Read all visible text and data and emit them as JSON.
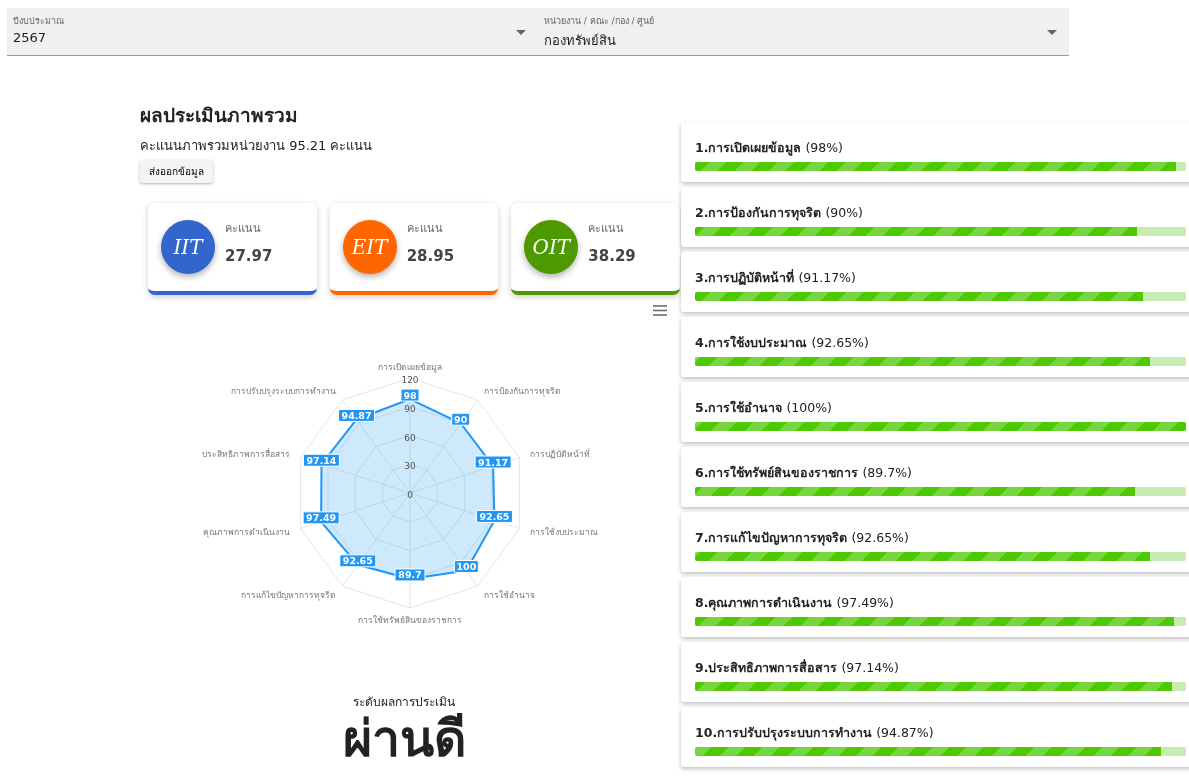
{
  "filters": [
    {
      "label": "ปีงบประมาณ",
      "value": "2567"
    },
    {
      "label": "หน่วยงาน / คณะ /กอง / ศูนย์",
      "value": "กองทรัพย์สิน"
    }
  ],
  "summary": {
    "title": "ผลประเมินภาพรวม",
    "subtitle": "คะแนนภาพรวมหน่วยงาน 95.21 คะแนน",
    "export_button": "ส่งออกข้อมูล"
  },
  "score_cards": [
    {
      "badge": "IIT",
      "color": "#3366cc",
      "caption": "คะแนน",
      "value": "27.97"
    },
    {
      "badge": "EIT",
      "color": "#ff6600",
      "caption": "คะแนน",
      "value": "28.95"
    },
    {
      "badge": "OIT",
      "color": "#4c9900",
      "caption": "คะแนน",
      "value": "38.29"
    }
  ],
  "radar": {
    "chart_data": {
      "type": "radar",
      "categories": [
        "การเปิดเผยข้อมูล",
        "การป้องกันการทุจริต",
        "การปฏิบัติหน้าที่",
        "การใช้งบประมาณ",
        "การใช้อำนาจ",
        "การใช้ทรัพย์สินของราชการ",
        "การแก้ไขปัญหาการทุจริต",
        "คุณภาพการดำเนินงาน",
        "ประสิทธิภาพการสื่อสาร",
        "การปรับปรุงระบบการทำงาน"
      ],
      "series": [
        {
          "color": "#2196f3",
          "values": [
            98,
            90,
            91.17,
            92.65,
            100,
            89.7,
            92.65,
            97.49,
            97.14,
            94.87
          ]
        }
      ],
      "ylim": [
        0,
        120
      ],
      "yticks": [
        0,
        30,
        60,
        90,
        120
      ],
      "data_labels": true
    }
  },
  "result": {
    "caption": "ระดับผลการประเมิน",
    "grade": "ผ่านดี"
  },
  "indicators": [
    {
      "label": "**1.การเปิดเผยข้อมูล** (98%)",
      "level": 0.98
    },
    {
      "label": "**2.การป้องกันการทุจริต** (90%)",
      "level": 0.9
    },
    {
      "label": "**3.การปฏิบัติหน้าที่** (91.17%)",
      "level": 0.9117
    },
    {
      "label": "**4.การใช้งบประมาณ** (92.65%)",
      "level": 0.9265
    },
    {
      "label": "**5.การใช้อำนาจ** (100%)",
      "level": 1
    },
    {
      "label": "**6.การใช้ทรัพย์สินของราชการ** (89.7%)",
      "level": 0.897
    },
    {
      "label": "**7.การแก้ไขปัญหาการทุจริต** (92.65%)",
      "level": 0.9265
    },
    {
      "label": "**8.คุณภาพการดำเนินงาน** (97.49%)",
      "level": 0.9749
    },
    {
      "label": "**9.ประสิทธิภาพการสื่อสาร** (97.14%)",
      "level": 0.9714
    },
    {
      "label": "**10.การปรับปรุงระบบการทำงาน** (94.87%)",
      "level": 0.9487
    }
  ]
}
